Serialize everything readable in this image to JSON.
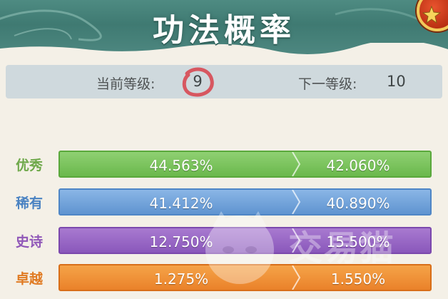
{
  "header": {
    "title": "功法概率"
  },
  "level": {
    "current_label": "当前等级:",
    "current_value": "9",
    "next_label": "下一等级:",
    "next_value": "10"
  },
  "rows": [
    {
      "label": "优秀",
      "current": "44.563%",
      "next": "42.060%",
      "color": "#6ab84c"
    },
    {
      "label": "稀有",
      "current": "41.412%",
      "next": "40.890%",
      "color": "#5f94d0"
    },
    {
      "label": "史诗",
      "current": "12.750%",
      "next": "15.500%",
      "color": "#8a58bb"
    },
    {
      "label": "卓越",
      "current": "1.275%",
      "next": "1.550%",
      "color": "#ea822a"
    }
  ],
  "watermark": {
    "text": "交易猫"
  },
  "icons": {
    "close": "close-star-icon",
    "arrow": "chevron-right-icon",
    "ring": "brush-ring-icon"
  }
}
